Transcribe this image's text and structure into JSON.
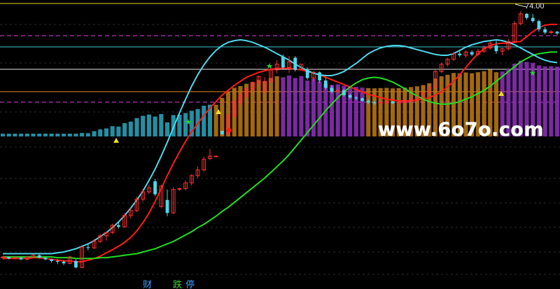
{
  "chart": {
    "price_label": "74.00",
    "watermark": "www.6o7o.com",
    "bottom_tags": [
      {
        "text": "财",
        "color": "#3aa0ff"
      },
      {
        "text": "跌",
        "color": "#3ccc3c"
      },
      {
        "text": "停",
        "color": "#3aa0ff"
      }
    ]
  },
  "chart_data": {
    "type": "candlestick",
    "candles": [
      [
        48.1,
        48.3,
        47.9,
        48.2
      ],
      [
        48.2,
        48.2,
        47.9,
        48.0
      ],
      [
        48.0,
        48.3,
        47.9,
        48.1
      ],
      [
        48.1,
        48.2,
        47.8,
        47.9
      ],
      [
        47.9,
        48.3,
        47.8,
        48.2
      ],
      [
        48.2,
        48.5,
        48.1,
        48.4
      ],
      [
        48.4,
        48.5,
        48.0,
        48.1
      ],
      [
        48.1,
        48.2,
        47.8,
        47.9
      ],
      [
        47.9,
        48.0,
        47.5,
        47.7
      ],
      [
        47.7,
        47.9,
        47.3,
        47.6
      ],
      [
        47.6,
        47.8,
        47.2,
        47.4
      ],
      [
        47.4,
        48.3,
        47.3,
        48.2
      ],
      [
        47.7,
        47.9,
        46.8,
        46.9
      ],
      [
        46.9,
        49.5,
        46.8,
        49.4
      ],
      [
        49.4,
        49.8,
        49.0,
        49.3
      ],
      [
        49.3,
        50.4,
        49.2,
        50.1
      ],
      [
        50.1,
        51.0,
        49.9,
        50.8
      ],
      [
        50.8,
        51.3,
        50.2,
        51.2
      ],
      [
        51.2,
        52.3,
        51.0,
        52.1
      ],
      [
        52.1,
        52.5,
        51.7,
        51.9
      ],
      [
        51.9,
        53.6,
        51.8,
        53.3
      ],
      [
        53.3,
        54.2,
        52.9,
        53.9
      ],
      [
        53.9,
        55.6,
        53.7,
        55.3
      ],
      [
        55.3,
        56.6,
        55.0,
        56.2
      ],
      [
        56.2,
        57.1,
        55.9,
        56.7
      ],
      [
        57.5,
        57.8,
        55.7,
        55.9
      ],
      [
        54.4,
        57.1,
        54.2,
        56.9
      ],
      [
        55.2,
        56.5,
        53.2,
        53.6
      ],
      [
        53.6,
        56.8,
        53.5,
        56.5
      ],
      [
        56.5,
        56.7,
        56.3,
        56.6
      ],
      [
        56.6,
        57.6,
        56.4,
        57.3
      ],
      [
        57.3,
        58.4,
        57.0,
        58.2
      ],
      [
        58.2,
        59.3,
        57.9,
        58.9
      ],
      [
        58.9,
        60.5,
        58.7,
        60.2
      ],
      [
        60.3,
        61.5,
        60.1,
        60.6
      ],
      [
        60.6,
        60.6,
        60.6,
        60.6
      ],
      [
        63.7,
        63.7,
        63.2,
        63.3
      ],
      [
        63.3,
        65.7,
        63.2,
        65.6
      ],
      [
        65.6,
        67.6,
        65.4,
        67.3
      ],
      [
        67.3,
        68.4,
        66.9,
        68.0
      ],
      [
        68.0,
        69.0,
        67.8,
        68.9
      ],
      [
        68.9,
        69.8,
        68.5,
        69.6
      ],
      [
        69.6,
        70.5,
        69.3,
        70.4
      ],
      [
        68.6,
        70.3,
        68.3,
        69.8
      ],
      [
        69.8,
        71.6,
        69.6,
        71.2
      ],
      [
        71.2,
        72.4,
        70.8,
        71.9
      ],
      [
        72.8,
        73.1,
        71.2,
        71.5
      ],
      [
        71.5,
        72.9,
        70.8,
        72.2
      ],
      [
        72.7,
        72.9,
        71.0,
        71.2
      ],
      [
        71.3,
        71.9,
        71.3,
        71.9
      ],
      [
        71.2,
        71.5,
        70.0,
        70.2
      ],
      [
        70.2,
        71.1,
        69.8,
        70.9
      ],
      [
        70.9,
        71.0,
        69.6,
        69.9
      ],
      [
        69.9,
        70.2,
        68.8,
        69.0
      ],
      [
        69.0,
        69.3,
        68.3,
        68.5
      ],
      [
        68.5,
        69.0,
        68.3,
        68.7
      ],
      [
        68.7,
        68.9,
        67.9,
        68.1
      ],
      [
        68.1,
        68.3,
        67.6,
        67.8
      ],
      [
        67.8,
        68.0,
        67.5,
        67.7
      ],
      [
        67.7,
        67.8,
        67.3,
        67.4
      ],
      [
        67.4,
        67.6,
        67.0,
        67.2
      ],
      [
        67.2,
        67.4,
        66.9,
        67.1
      ],
      [
        67.1,
        67.3,
        67.0,
        67.2
      ],
      [
        67.2,
        67.5,
        67.0,
        67.3
      ],
      [
        67.3,
        67.4,
        67.0,
        67.1
      ],
      [
        67.1,
        67.3,
        67.0,
        67.2
      ],
      [
        67.2,
        67.5,
        67.1,
        67.4
      ],
      [
        67.4,
        67.7,
        67.2,
        67.6
      ],
      [
        67.6,
        68.0,
        67.4,
        67.9
      ],
      [
        67.9,
        68.5,
        67.8,
        68.4
      ],
      [
        68.4,
        69.3,
        68.2,
        69.1
      ],
      [
        69.1,
        71.2,
        69.0,
        71.0
      ],
      [
        71.0,
        72.1,
        70.8,
        71.9
      ],
      [
        71.9,
        72.7,
        71.6,
        72.5
      ],
      [
        72.5,
        73.4,
        72.3,
        73.2
      ],
      [
        73.2,
        73.5,
        72.8,
        73.0
      ],
      [
        73.0,
        73.6,
        72.7,
        73.4
      ],
      [
        73.4,
        73.6,
        72.9,
        73.1
      ],
      [
        73.1,
        73.8,
        72.9,
        73.5
      ],
      [
        73.5,
        74.2,
        73.3,
        73.9
      ],
      [
        73.9,
        74.7,
        73.7,
        74.5
      ],
      [
        74.2,
        74.8,
        73.2,
        73.5
      ],
      [
        73.5,
        73.9,
        73.0,
        73.8
      ],
      [
        73.8,
        75.0,
        73.6,
        74.7
      ],
      [
        74.7,
        77.2,
        74.5,
        76.9
      ],
      [
        76.9,
        78.4,
        76.7,
        78.1
      ],
      [
        78.1,
        78.2,
        77.4,
        77.6
      ],
      [
        77.6,
        78.1,
        77.0,
        77.2
      ],
      [
        77.2,
        77.4,
        75.9,
        76.2
      ],
      [
        76.2,
        76.5,
        75.6,
        75.8
      ],
      [
        75.8,
        76.1,
        75.6,
        75.9
      ],
      [
        75.9,
        76.0,
        75.5,
        75.7
      ]
    ],
    "series": [
      {
        "color": "#ff1a1a",
        "values": [
          48.0,
          48.0,
          48.0,
          48.0,
          48.0,
          48.1,
          48.1,
          48.0,
          47.9,
          47.8,
          47.7,
          47.7,
          47.6,
          47.6,
          47.8,
          48.0,
          48.3,
          48.7,
          49.1,
          49.5,
          50.0,
          50.6,
          51.4,
          52.4,
          53.6,
          55.0,
          56.6,
          58.2,
          59.7,
          61.1,
          62.4,
          63.6,
          64.6,
          65.6,
          66.5,
          67.3,
          68.1,
          68.7,
          69.3,
          69.8,
          70.3,
          70.6,
          70.9,
          71.1,
          71.3,
          71.4,
          71.4,
          71.4,
          71.3,
          71.2,
          71.0,
          70.8,
          70.6,
          70.3,
          70.0,
          69.7,
          69.4,
          69.1,
          68.8,
          68.5,
          68.2,
          68.0,
          67.8,
          67.6,
          67.5,
          67.4,
          67.4,
          67.4,
          67.5,
          67.6,
          67.8,
          68.1,
          68.5,
          69.1,
          69.8,
          70.6,
          71.5,
          72.4,
          73.2,
          73.8,
          74.2,
          74.4,
          74.5,
          74.5,
          74.6,
          74.7,
          75.3,
          75.9,
          76.4,
          76.7,
          76.8,
          76.8
        ]
      },
      {
        "color": "#22dd22",
        "values": [
          48.2,
          48.2,
          48.2,
          48.2,
          48.2,
          48.2,
          48.2,
          48.2,
          48.2,
          48.1,
          48.1,
          48.1,
          48.0,
          48.0,
          48.0,
          48.0,
          48.1,
          48.1,
          48.2,
          48.3,
          48.4,
          48.5,
          48.6,
          48.8,
          49.0,
          49.2,
          49.5,
          49.8,
          50.1,
          50.5,
          50.9,
          51.3,
          51.8,
          52.2,
          52.7,
          53.2,
          53.8,
          54.3,
          54.9,
          55.5,
          56.1,
          56.7,
          57.3,
          57.9,
          58.6,
          59.3,
          60.0,
          60.8,
          61.7,
          62.6,
          63.5,
          64.4,
          65.3,
          66.2,
          67.0,
          67.8,
          68.5,
          69.1,
          69.6,
          70.0,
          70.2,
          70.3,
          70.2,
          70.0,
          69.7,
          69.3,
          68.9,
          68.4,
          68.0,
          67.6,
          67.3,
          67.1,
          67.0,
          67.0,
          67.1,
          67.3,
          67.6,
          67.9,
          68.3,
          68.7,
          69.2,
          69.8,
          70.4,
          71.0,
          71.6,
          72.2,
          72.6,
          73.0,
          73.2,
          73.3,
          73.4,
          73.4
        ]
      },
      {
        "color": "#4fd8ea",
        "values": [
          48.6,
          48.6,
          48.6,
          48.6,
          48.6,
          48.6,
          48.6,
          48.6,
          48.6,
          48.7,
          48.8,
          49.0,
          49.2,
          49.5,
          49.8,
          50.2,
          50.7,
          51.2,
          51.8,
          52.5,
          53.3,
          54.2,
          55.2,
          56.3,
          57.6,
          59.0,
          60.6,
          62.3,
          64.1,
          65.9,
          67.6,
          69.2,
          70.6,
          71.8,
          72.8,
          73.6,
          74.2,
          74.6,
          74.8,
          74.9,
          74.8,
          74.6,
          74.3,
          74.0,
          73.6,
          73.2,
          72.8,
          72.4,
          71.9,
          71.5,
          71.1,
          70.8,
          70.6,
          70.5,
          70.5,
          70.7,
          71.0,
          71.5,
          72.0,
          72.6,
          73.2,
          73.6,
          73.9,
          74.1,
          74.2,
          74.2,
          74.1,
          73.9,
          73.7,
          73.5,
          73.3,
          73.1,
          73.0,
          73.0,
          73.2,
          73.6,
          74.0,
          74.3,
          74.5,
          74.7,
          74.8,
          74.9,
          74.8,
          74.6,
          74.3,
          73.9,
          73.5,
          73.1,
          72.7,
          72.4,
          72.2,
          72.1
        ]
      }
    ],
    "y_range": [
      45.8,
      79.8
    ]
  }
}
